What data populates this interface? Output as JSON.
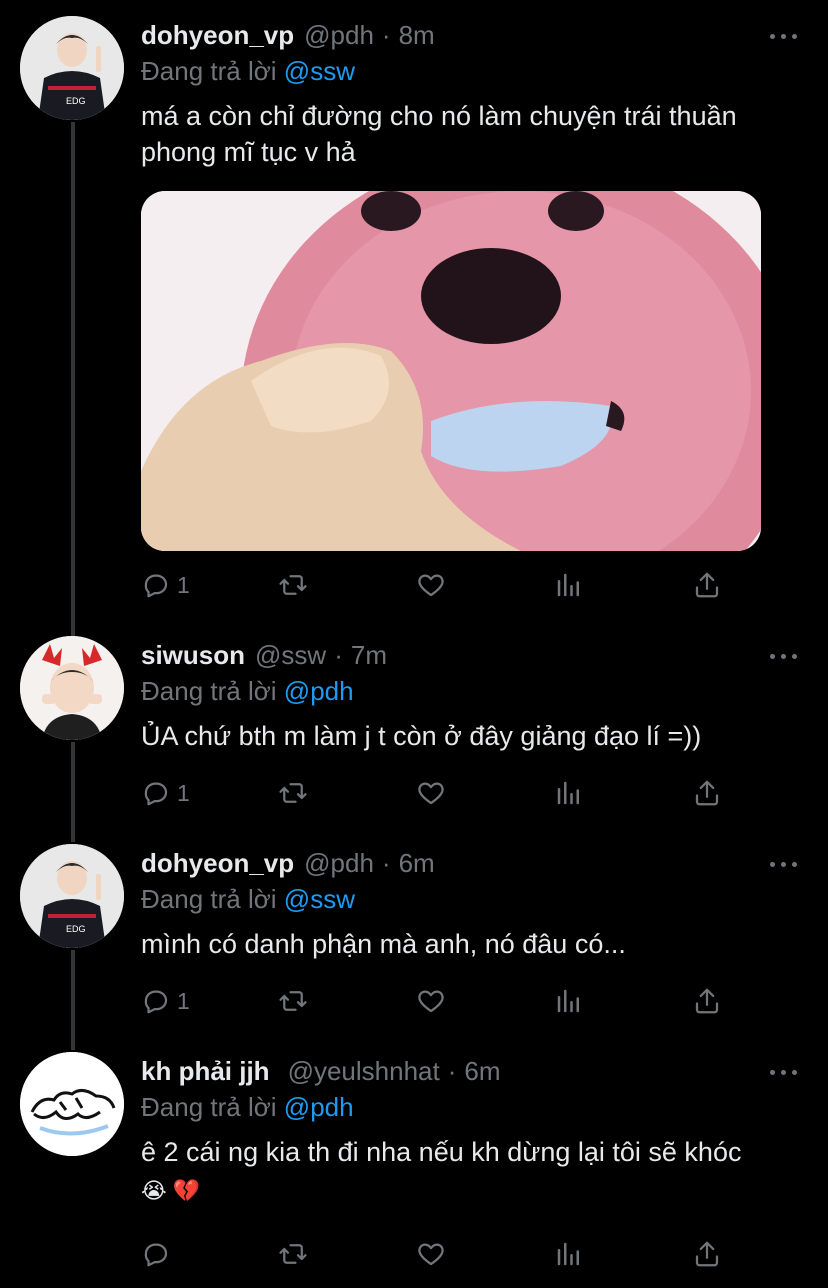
{
  "tweets": [
    {
      "name": "dohyeon_vp",
      "handle": "@pdh",
      "time": "8m",
      "replying_prefix": "Đang trả lời",
      "replying_to": "@ssw",
      "text_lines": [
        "má a còn chỉ đường cho nó làm chuyện trái thuần",
        "phong mĩ tục v hả"
      ],
      "reply_count": "1"
    },
    {
      "name": "siwuson",
      "handle": "@ssw",
      "time": "7m",
      "replying_prefix": "Đang trả lời",
      "replying_to": "@pdh",
      "text_lines": [
        "ỦA chứ bth m làm j t còn ở đây giảng đạo lí =))"
      ],
      "reply_count": "1"
    },
    {
      "name": "dohyeon_vp",
      "handle": "@pdh",
      "time": "6m",
      "replying_prefix": "Đang trả lời",
      "replying_to": "@ssw",
      "text_lines": [
        "mình có danh phận mà anh, nó đâu có..."
      ],
      "reply_count": "1"
    },
    {
      "name": "kh phải jjh",
      "handle": "@yeulshnhat",
      "time": "6m",
      "replying_prefix": "Đang trả lời",
      "replying_to": "@pdh",
      "text_lines": [
        "ê 2 cái ng kia th đi nha nếu kh dừng lại tôi sẽ khóc"
      ],
      "emojis": "😭 💔",
      "reply_count": ""
    }
  ],
  "icons": {
    "reply": "reply-icon",
    "retweet": "retweet-icon",
    "like": "heart-icon",
    "views": "analytics-icon",
    "share": "share-icon",
    "more": "more-options-icon"
  },
  "colors": {
    "background": "#000000",
    "text": "#e7e9ea",
    "muted": "#71767b",
    "link": "#1d9bf0",
    "thread_line": "#333639"
  }
}
